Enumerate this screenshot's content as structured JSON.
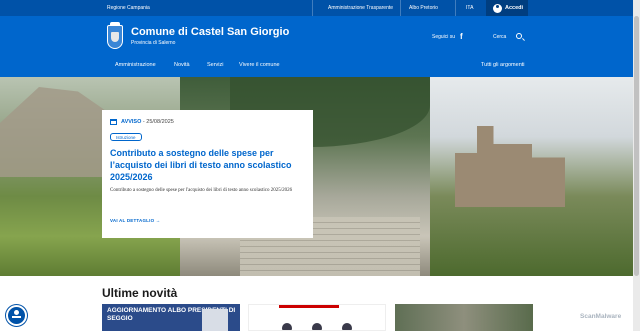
{
  "topbar": {
    "region": "Regione Campania",
    "links": [
      "Amministrazione Trasparente",
      "Albo Pretorio",
      "ITA"
    ],
    "login_label": "Accedi"
  },
  "header": {
    "title": "Comune di Castel San Giorgio",
    "subtitle": "Provincia di Salerno",
    "follow_label": "Seguici su",
    "search_label": "Cerca"
  },
  "nav": {
    "items": [
      "Amministrazione",
      "Novità",
      "Servizi",
      "Vivere il comune"
    ],
    "all_topics": "Tutti gli argomenti"
  },
  "hero_card": {
    "category": "AVVISO",
    "date": "25/08/2025",
    "tag": "Istruzione",
    "headline": "Contributo a sostegno delle spese per l’acquisto dei libri di testo anno scolastico 2025/2026",
    "description": "Contributo a sostegno delle spese per l'acquisto dei libri di testo anno scolastico 2025/2026",
    "more": "VAI AL DETTAGLIO"
  },
  "news": {
    "title": "Ultime novità",
    "thumb1_text": "AGGIORNAMENTO ALBO PRESIDENTI DI SEGGIO"
  },
  "watermark": "ScanMalware",
  "colors": {
    "brand": "#0066cc",
    "topbar": "#0052a8"
  }
}
